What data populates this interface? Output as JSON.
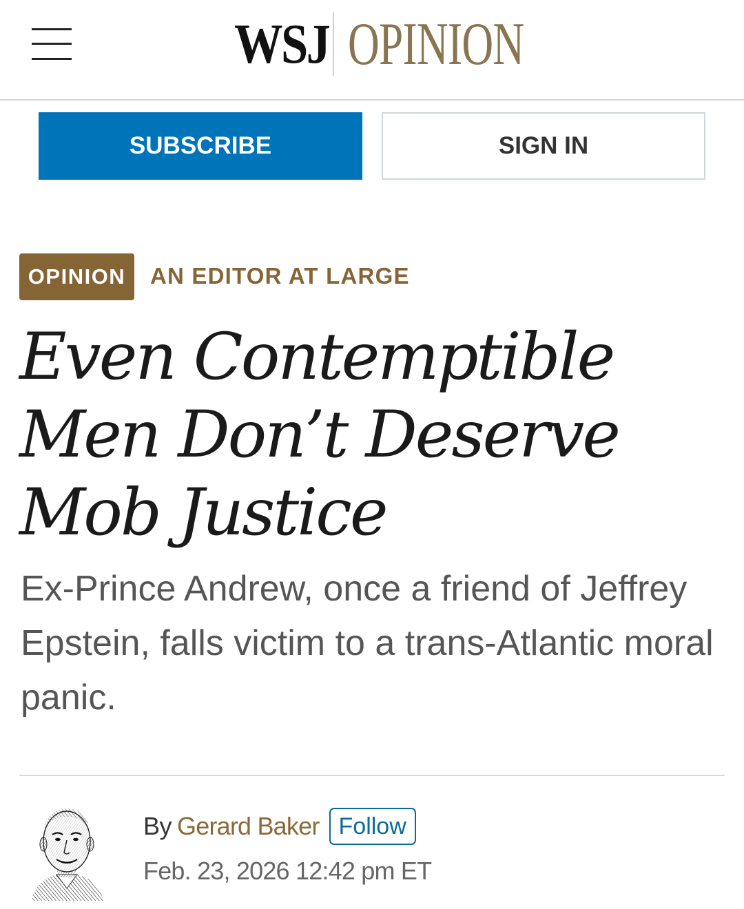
{
  "header": {
    "menu_icon": "hamburger-menu-icon",
    "logo_wsj": "WSJ",
    "logo_section": "OPINION"
  },
  "auth": {
    "subscribe_label": "SUBSCRIBE",
    "signin_label": "SIGN IN"
  },
  "article": {
    "section_tag": "OPINION",
    "column_name": "AN EDITOR AT LARGE",
    "headline": "Even Contemptible Men Don’t Deserve Mob Justice",
    "dek": "Ex-Prince Andrew, once a friend of Jeffrey Epstein, falls victim to a trans-Atlantic moral panic.",
    "byline": {
      "by_label": "By",
      "author": "Gerard Baker",
      "follow_label": "Follow",
      "timestamp": "Feb. 23, 2026 12:42 pm ET"
    }
  },
  "colors": {
    "subscribe_blue": "#0074b8",
    "opinion_brown": "#856435",
    "logo_gold": "#8a7551",
    "follow_blue": "#0a6a9e"
  }
}
